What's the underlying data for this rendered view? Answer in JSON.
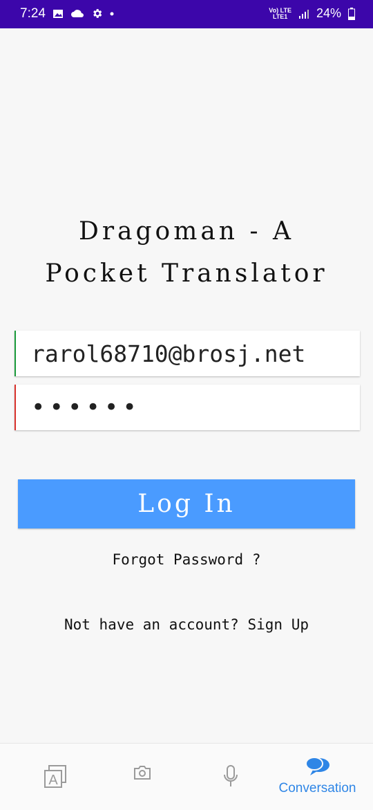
{
  "status_bar": {
    "time": "7:24",
    "network_top": "Vo) LTE",
    "network_bottom": "LTE1",
    "battery": "24%"
  },
  "app": {
    "title_line1": "Dragoman - A",
    "title_line2": "Pocket Translator"
  },
  "login": {
    "email_value": "rarol68710@brosj.net",
    "password_value": "••••••",
    "login_label": "Log In",
    "forgot_label": "Forgot Password ?",
    "signup_prefix": "Not have an account?",
    "signup_link": "Sign Up"
  },
  "bottom_nav": {
    "active_label": "Conversation"
  },
  "colors": {
    "status_bar": "#3c06aa",
    "button": "#4a9bff",
    "accent": "#2f86e6",
    "email_border": "#1a9a3a",
    "password_border": "#d9322d"
  }
}
